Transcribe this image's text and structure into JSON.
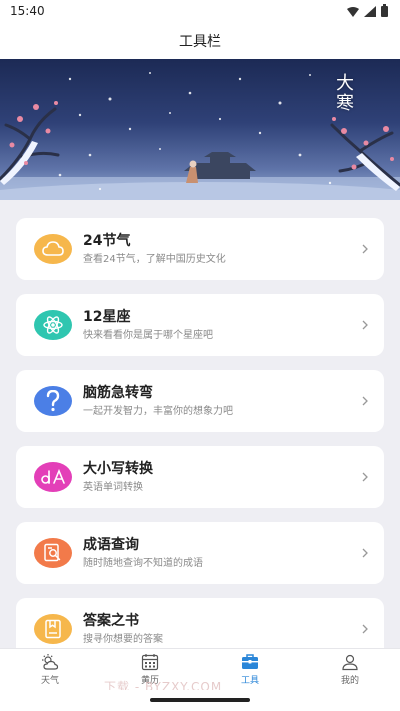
{
  "status": {
    "time": "15:40"
  },
  "header": {
    "title": "工具栏"
  },
  "banner": {
    "text": "大寒"
  },
  "tools": [
    {
      "title": "24节气",
      "subtitle": "查看24节气，了解中国历史文化",
      "icon": "cloud-icon",
      "color": "#f6b74c"
    },
    {
      "title": "12星座",
      "subtitle": "快来看看你是属于哪个星座吧",
      "icon": "atom-icon",
      "color": "#2fc6b0"
    },
    {
      "title": "脑筋急转弯",
      "subtitle": "一起开发智力，丰富你的想象力吧",
      "icon": "question-icon",
      "color": "#4b7fe6"
    },
    {
      "title": "大小写转换",
      "subtitle": "英语单词转换",
      "icon": "case-convert-icon",
      "color": "#e33fb8"
    },
    {
      "title": "成语查询",
      "subtitle": "随时随地查询不知道的成语",
      "icon": "search-doc-icon",
      "color": "#f27a4a"
    },
    {
      "title": "答案之书",
      "subtitle": "搜寻你想要的答案",
      "icon": "book-icon",
      "color": "#f6b74c"
    }
  ],
  "tabs": [
    {
      "label": "天气",
      "icon": "weather-icon"
    },
    {
      "label": "黄历",
      "icon": "calendar-icon"
    },
    {
      "label": "工具",
      "icon": "toolbox-icon",
      "active": true
    },
    {
      "label": "我的",
      "icon": "user-icon"
    }
  ],
  "watermark": "下载 - BYZXY.COM",
  "colors": {
    "accent": "#2a86d8",
    "background": "#eeeef3"
  }
}
